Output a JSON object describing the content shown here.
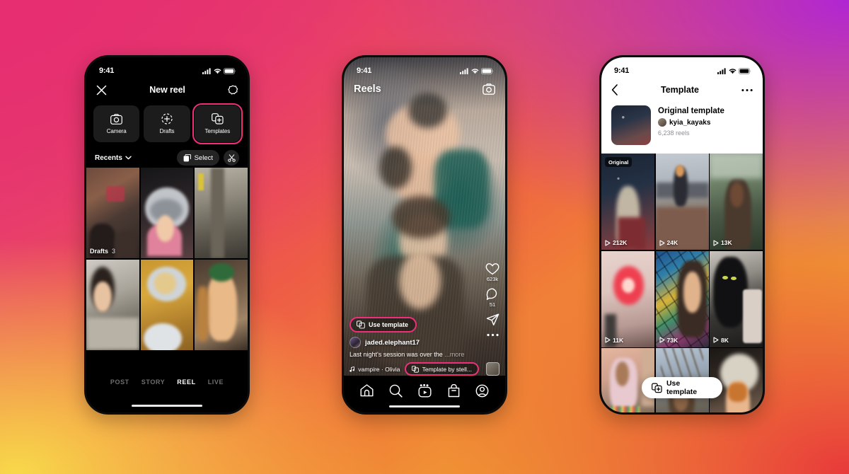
{
  "background": {
    "colors": [
      "#E62E70",
      "#B026D3",
      "#F5D13C",
      "#E8393A"
    ]
  },
  "accent": "#F12E7A",
  "phone1": {
    "name": "new-reel-composer",
    "status": {
      "time": "9:41"
    },
    "nav": {
      "close_icon": "close-icon",
      "title": "New reel",
      "settings_icon": "settings-icon"
    },
    "modes": [
      {
        "icon": "camera-icon",
        "label": "Camera",
        "selected": false
      },
      {
        "icon": "drafts-plus-icon",
        "label": "Drafts",
        "selected": false
      },
      {
        "icon": "templates-icon",
        "label": "Templates",
        "selected": true
      }
    ],
    "toolbar": {
      "source_label": "Recents",
      "chevron_icon": "chevron-down-icon",
      "select_label": "Select",
      "select_icon": "multi-select-icon",
      "cut_icon": "scissors-icon"
    },
    "gallery": {
      "drafts_label": "Drafts",
      "drafts_count": "3"
    },
    "bottom_modes": [
      {
        "label": "POST",
        "active": false
      },
      {
        "label": "STORY",
        "active": false
      },
      {
        "label": "REEL",
        "active": true
      },
      {
        "label": "LIVE",
        "active": false
      }
    ]
  },
  "phone2": {
    "name": "reels-player",
    "status": {
      "time": "9:41"
    },
    "top": {
      "title": "Reels",
      "camera_icon": "camera-icon"
    },
    "actions": [
      {
        "icon": "heart-icon",
        "count": "623k"
      },
      {
        "icon": "comment-icon",
        "count": "51"
      },
      {
        "icon": "share-icon",
        "count": ""
      }
    ],
    "more_icon": "more-horizontal-icon",
    "use_template": {
      "label": "Use template",
      "icon": "templates-icon"
    },
    "post": {
      "username": "jaded.elephant17",
      "caption": "Last night's session was over the",
      "more_label": "...more"
    },
    "music": {
      "icon": "music-note-icon",
      "text": "vampire · Olivia R...",
      "template_credit": "Template by stell...",
      "template_icon": "templates-icon"
    },
    "tabbar": [
      {
        "icon": "home-icon",
        "label": "Home"
      },
      {
        "icon": "search-icon",
        "label": "Search"
      },
      {
        "icon": "reels-icon",
        "label": "Reels"
      },
      {
        "icon": "shop-icon",
        "label": "Shop"
      },
      {
        "icon": "profile-icon",
        "label": "Profile"
      }
    ]
  },
  "phone3": {
    "name": "template-detail",
    "status": {
      "time": "9:41"
    },
    "nav": {
      "back_icon": "back-chevron-icon",
      "title": "Template",
      "more_icon": "more-horizontal-icon"
    },
    "template": {
      "name": "Original template",
      "username": "kyia_kayaks",
      "reels_count": "6,238 reels",
      "original_badge": "Original"
    },
    "grid": [
      {
        "views": "212K",
        "badge": "Original"
      },
      {
        "views": "24K",
        "badge": ""
      },
      {
        "views": "13K",
        "badge": ""
      },
      {
        "views": "11K",
        "badge": ""
      },
      {
        "views": "73K",
        "badge": ""
      },
      {
        "views": "8K",
        "badge": ""
      },
      {
        "views": "",
        "badge": ""
      },
      {
        "views": "",
        "badge": ""
      },
      {
        "views": "",
        "badge": ""
      }
    ],
    "use_template": {
      "label": "Use template",
      "icon": "templates-icon"
    }
  }
}
